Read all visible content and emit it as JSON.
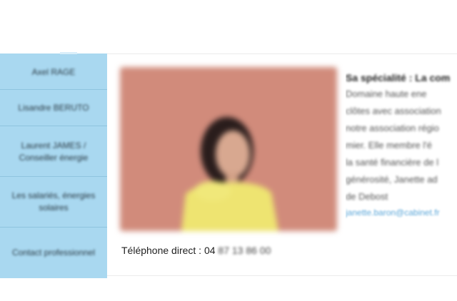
{
  "sidebar": {
    "items": [
      {
        "label": "Axel RAGE"
      },
      {
        "label": "Lisandre BERUTO"
      },
      {
        "label": "Laurent JAMES / Conseiller énergie"
      },
      {
        "label": "Les salariés, énergies solaires"
      },
      {
        "label": "Contact professionnel"
      }
    ]
  },
  "profile": {
    "photo_alt": "portrait",
    "phone_label": "Téléphone direct : 04",
    "phone_rest": "87 13 86 00",
    "specialty_title": "Sa spécialité : La com",
    "description_lines": [
      "Domaine haute ene",
      "clôtes avec association",
      "notre association régio",
      "mier. Elle membre l'é",
      "la santé financière de l",
      "générosité, Janette ad",
      "de Debost"
    ],
    "email": "janette.baron@cabinet.fr"
  },
  "colors": {
    "sidebar_bg": "#a9d8f0",
    "photo_bg": "#cf8777",
    "link": "#5aa6d8"
  }
}
